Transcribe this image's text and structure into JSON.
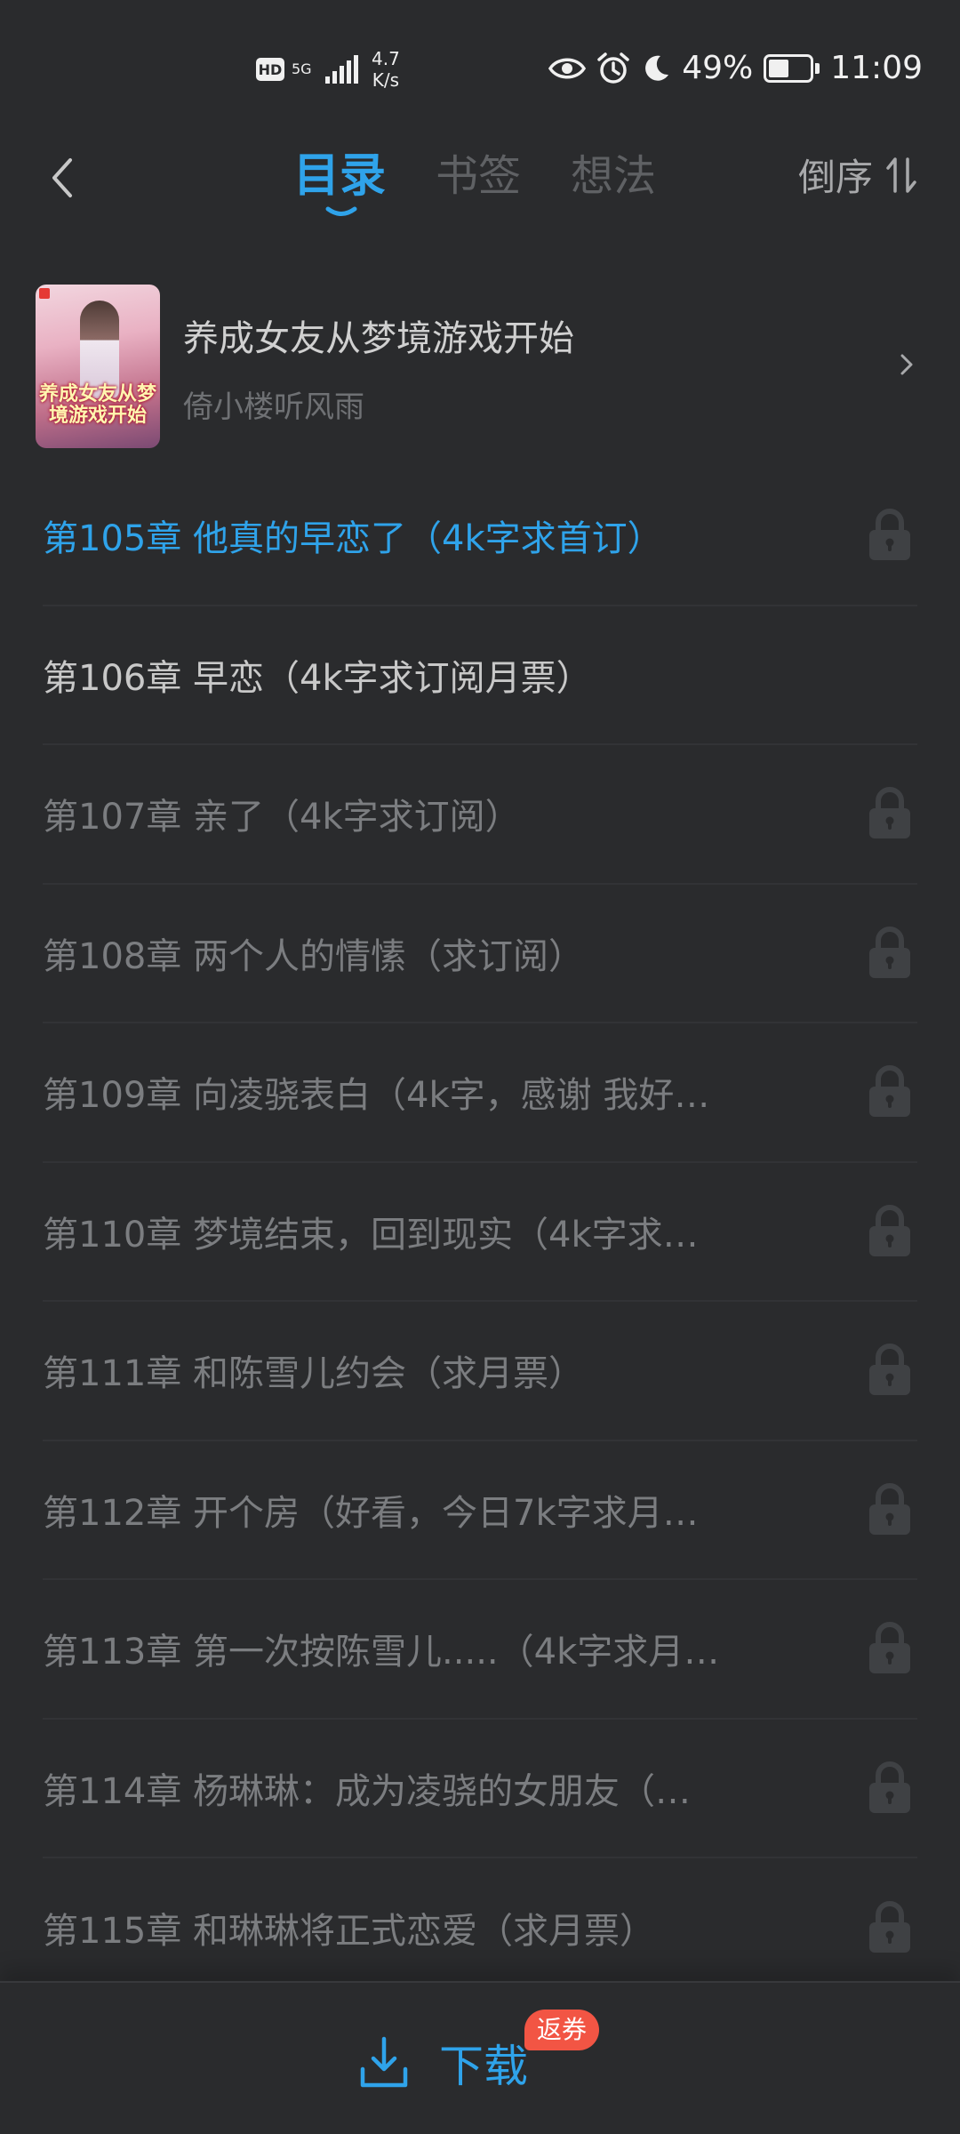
{
  "status_bar": {
    "hd": "HD",
    "network": "5G",
    "speed_value": "4.7",
    "speed_unit": "K/s",
    "battery_percent": "49%",
    "battery_level": 0.49,
    "time": "11:09",
    "icons": [
      "eye-icon",
      "alarm-icon",
      "moon-icon",
      "battery-icon"
    ]
  },
  "header": {
    "tabs": [
      {
        "label": "目录",
        "active": true
      },
      {
        "label": "书签",
        "active": false
      },
      {
        "label": "想法",
        "active": false
      }
    ],
    "sort_label": "倒序"
  },
  "book": {
    "title": "养成女友从梦境游戏开始",
    "author": "倚小楼听风雨",
    "cover_text": "养成女友从梦境游戏开始"
  },
  "chapters": [
    {
      "title": "第105章 他真的早恋了（4k字求首订）",
      "state": "current",
      "locked": true
    },
    {
      "title": "第106章 早恋（4k字求订阅月票）",
      "state": "read",
      "locked": false
    },
    {
      "title": "第107章 亲了（4k字求订阅）",
      "state": "locked",
      "locked": true
    },
    {
      "title": "第108章 两个人的情愫（求订阅）",
      "state": "locked",
      "locked": true
    },
    {
      "title": "第109章 向凌骁表白（4k字，感谢 我好…",
      "state": "locked",
      "locked": true
    },
    {
      "title": "第110章 梦境结束，回到现实（4k字求…",
      "state": "locked",
      "locked": true
    },
    {
      "title": "第111章 和陈雪儿约会（求月票）",
      "state": "locked",
      "locked": true
    },
    {
      "title": "第112章 开个房（好看，今日7k字求月…",
      "state": "locked",
      "locked": true
    },
    {
      "title": "第113章 第一次按陈雪儿.....（4k字求月…",
      "state": "locked",
      "locked": true
    },
    {
      "title": "第114章 杨琳琳：成为凌骁的女朋友（…",
      "state": "locked",
      "locked": true
    },
    {
      "title": "第115章 和琳琳将正式恋爱（求月票）",
      "state": "locked",
      "locked": true
    }
  ],
  "bottom": {
    "download_label": "下载",
    "promo_badge": "返券"
  },
  "colors": {
    "background": "#2a2b2d",
    "accent": "#2fa3ea",
    "badge": "#f25544"
  }
}
